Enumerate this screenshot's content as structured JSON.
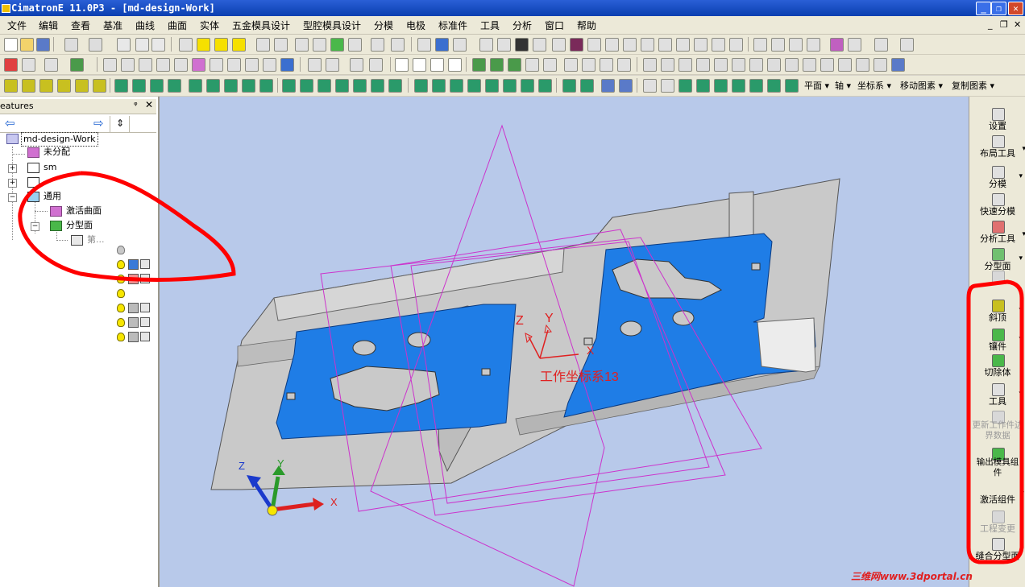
{
  "window": {
    "title": "CimatronE 11.0P3 - [md-design-Work]",
    "controls": [
      "_",
      "❐",
      "✕"
    ]
  },
  "menu": {
    "items": [
      "文件",
      "编辑",
      "查看",
      "基准",
      "曲线",
      "曲面",
      "实体",
      "五金模具设计",
      "型腔模具设计",
      "分模",
      "电极",
      "标准件",
      "工具",
      "分析",
      "窗口",
      "帮助"
    ],
    "mdi_controls": [
      "_",
      "❐",
      "✕"
    ]
  },
  "toolbar3": {
    "dropdowns": [
      "平面",
      "轴",
      "坐标系",
      "移动图素",
      "复制图素"
    ]
  },
  "features_panel": {
    "title": "eatures",
    "pin": "ᵠ",
    "close": "✕",
    "tree": [
      {
        "label": "md-design-Work"
      },
      {
        "label": "未分配"
      },
      {
        "label": "sm"
      },
      {
        "label": ""
      },
      {
        "label": "通用"
      },
      {
        "label": "激活曲面"
      },
      {
        "label": "分型面"
      },
      {
        "label": "第..."
      }
    ]
  },
  "viewport": {
    "coord_label": "工作坐标系13",
    "axis_labels": {
      "z": "Z",
      "y": "Y",
      "x": "X"
    },
    "colors": {
      "background": "#b8c9ea",
      "part_gray": "#c8c8c8",
      "part_blue": "#1f7de6",
      "plane_magenta": "#cc33cc",
      "annotation_red": "#ff0000"
    }
  },
  "right_panel": {
    "buttons": [
      {
        "label": "设置",
        "dropdown": ""
      },
      {
        "label": "布局工具",
        "dropdown": "▾"
      },
      {
        "label": "分模",
        "dropdown": "▾"
      },
      {
        "label": "快速分模",
        "dropdown": ""
      },
      {
        "label": "分析工具",
        "dropdown": "▾"
      },
      {
        "label": "分型面",
        "dropdown": "▾"
      },
      {
        "label": "斜顶",
        "dropdown": "▾"
      },
      {
        "label": "镶件",
        "dropdown": "▾"
      },
      {
        "label": "切除体",
        "dropdown": ""
      },
      {
        "label": "工具",
        "dropdown": "▾"
      },
      {
        "label": "更新工作件边界数据",
        "dropdown": ""
      },
      {
        "label": "输出模具组件",
        "dropdown": ""
      },
      {
        "label": "激活组件",
        "dropdown": "▾"
      },
      {
        "label": "工程变更",
        "dropdown": ""
      },
      {
        "label": "缝合分型面",
        "dropdown": ""
      }
    ]
  },
  "watermark": "三维网www.3dportal.cn"
}
